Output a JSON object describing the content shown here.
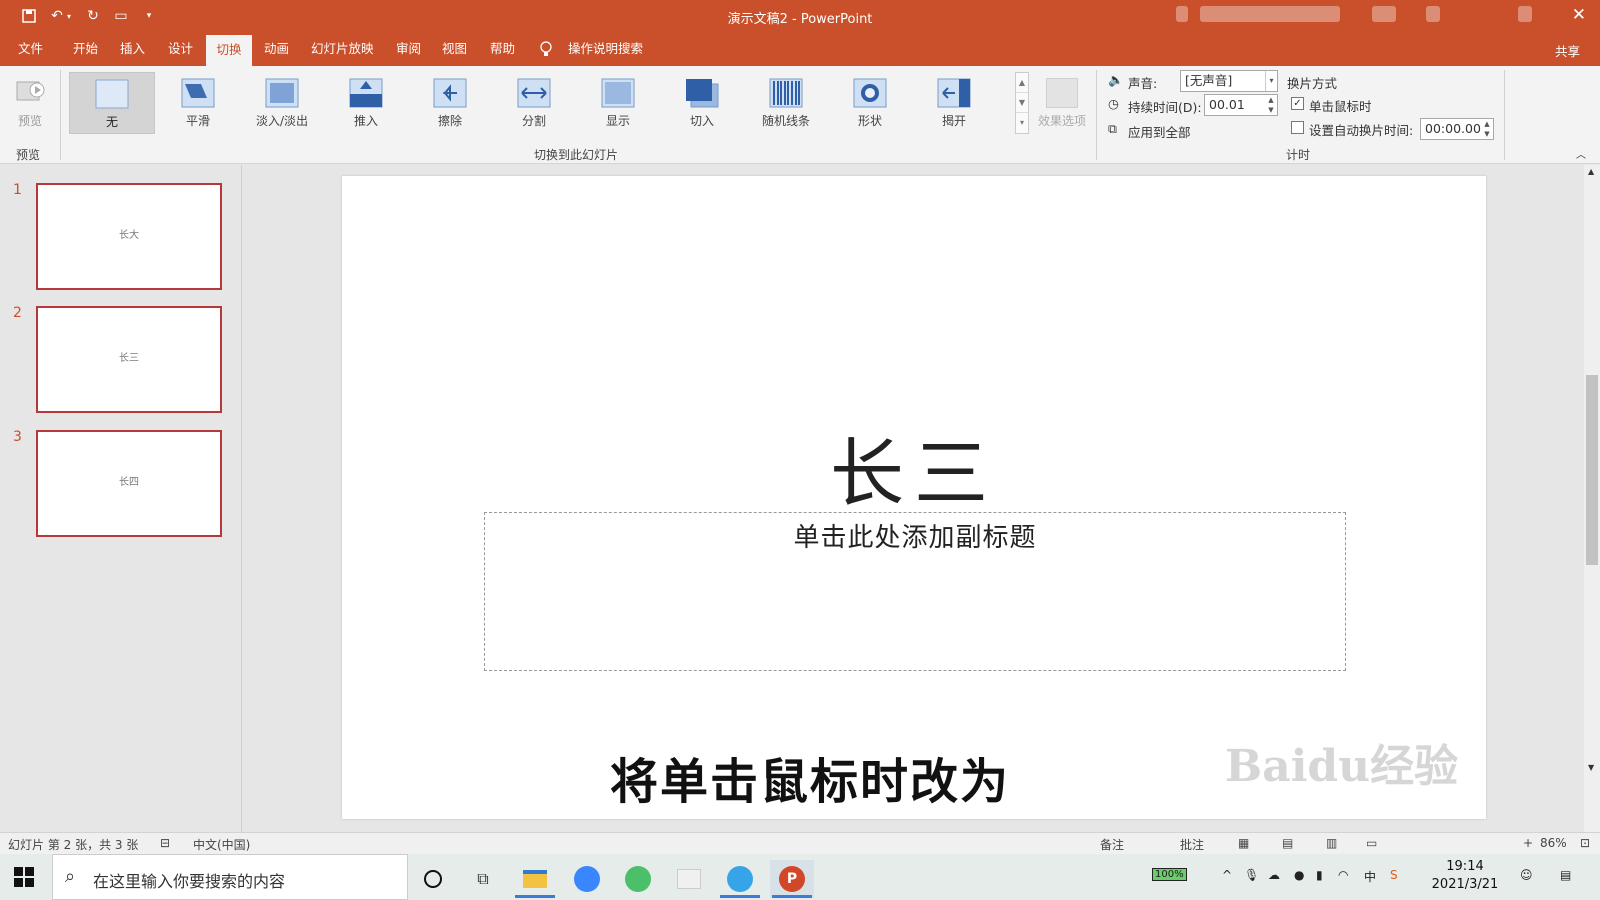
{
  "window": {
    "title": "演示文稿2 - PowerPoint",
    "close": "✕"
  },
  "tabs": [
    {
      "label": "文件"
    },
    {
      "label": "开始"
    },
    {
      "label": "插入"
    },
    {
      "label": "设计"
    },
    {
      "label": "切换",
      "active": true
    },
    {
      "label": "动画"
    },
    {
      "label": "幻灯片放映"
    },
    {
      "label": "审阅"
    },
    {
      "label": "视图"
    },
    {
      "label": "帮助"
    },
    {
      "label": "操作说明搜索"
    }
  ],
  "share_label": "共享",
  "ribbon": {
    "preview_label": "预览",
    "preview_group": "预览",
    "transition_group": "切换到此幻灯片",
    "transitions": [
      {
        "label": "无",
        "icon": "none-transition-icon",
        "selected": true
      },
      {
        "label": "平滑",
        "icon": "morph-icon"
      },
      {
        "label": "淡入/淡出",
        "icon": "fade-icon"
      },
      {
        "label": "推入",
        "icon": "push-icon"
      },
      {
        "label": "擦除",
        "icon": "wipe-icon"
      },
      {
        "label": "分割",
        "icon": "split-icon"
      },
      {
        "label": "显示",
        "icon": "reveal-icon"
      },
      {
        "label": "切入",
        "icon": "cut-icon"
      },
      {
        "label": "随机线条",
        "icon": "random-bars-icon"
      },
      {
        "label": "形状",
        "icon": "shape-icon"
      },
      {
        "label": "揭开",
        "icon": "uncover-icon"
      }
    ],
    "effect_options": "效果选项",
    "sound_label": "声音:",
    "sound_value": "[无声音]",
    "duration_label": "持续时间(D):",
    "duration_value": "00.01",
    "apply_all": "应用到全部",
    "advance_title": "换片方式",
    "on_click": "单击鼠标时",
    "on_click_checked": true,
    "after_label": "设置自动换片时间:",
    "after_value": "00:00.00",
    "after_checked": false,
    "timing_group": "计时"
  },
  "slides": [
    {
      "num": "1",
      "text": "长大"
    },
    {
      "num": "2",
      "text": "长三"
    },
    {
      "num": "3",
      "text": "长四"
    }
  ],
  "current_slide": {
    "title": "长三",
    "subtitle_placeholder": "单击此处添加副标题"
  },
  "caption": "将单击鼠标时改为",
  "statusbar": {
    "slide_info": "幻灯片 第 2 张，共 3 张",
    "language": "中文(中国)",
    "notes": "备注",
    "comments": "批注",
    "zoom": "86%"
  },
  "taskbar": {
    "search_placeholder": "在这里输入你要搜索的内容",
    "battery": "100%",
    "ime": "中",
    "time": "19:14",
    "date": "2021/3/21"
  },
  "watermark": "Baidu经验"
}
